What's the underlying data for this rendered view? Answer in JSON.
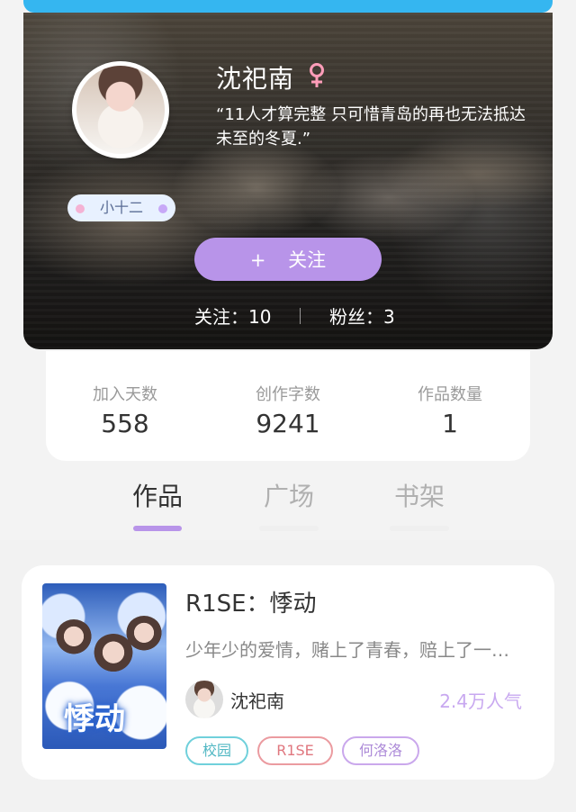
{
  "profile": {
    "username": "沈祀南",
    "bio": "“11人才算完整 只可惜青岛的再也无法抵达未至的冬夏.”",
    "nickname": "小十二",
    "follow_button": "关注",
    "follow_count_text": "关注：10",
    "fans_count_text": "粉丝：3",
    "gender": "female"
  },
  "stats": [
    {
      "label": "加入天数",
      "value": "558"
    },
    {
      "label": "创作字数",
      "value": "9241"
    },
    {
      "label": "作品数量",
      "value": "1"
    }
  ],
  "tabs": [
    {
      "label": "作品"
    },
    {
      "label": "广场"
    },
    {
      "label": "书架"
    }
  ],
  "work": {
    "title": "R1SE：悸动",
    "cover_title": "悸动",
    "description": "少年少的爱情，赌上了青春，赔上了一…",
    "author": "沈祀南",
    "popularity": "2.4万人气",
    "tags": [
      "校园",
      "R1SE",
      "何洛洛"
    ]
  },
  "colors": {
    "accent_purple": "#b894e9",
    "top_strip_blue": "#35b6f0"
  },
  "icons": {
    "gender": "female-icon",
    "plus": "plus-icon"
  }
}
